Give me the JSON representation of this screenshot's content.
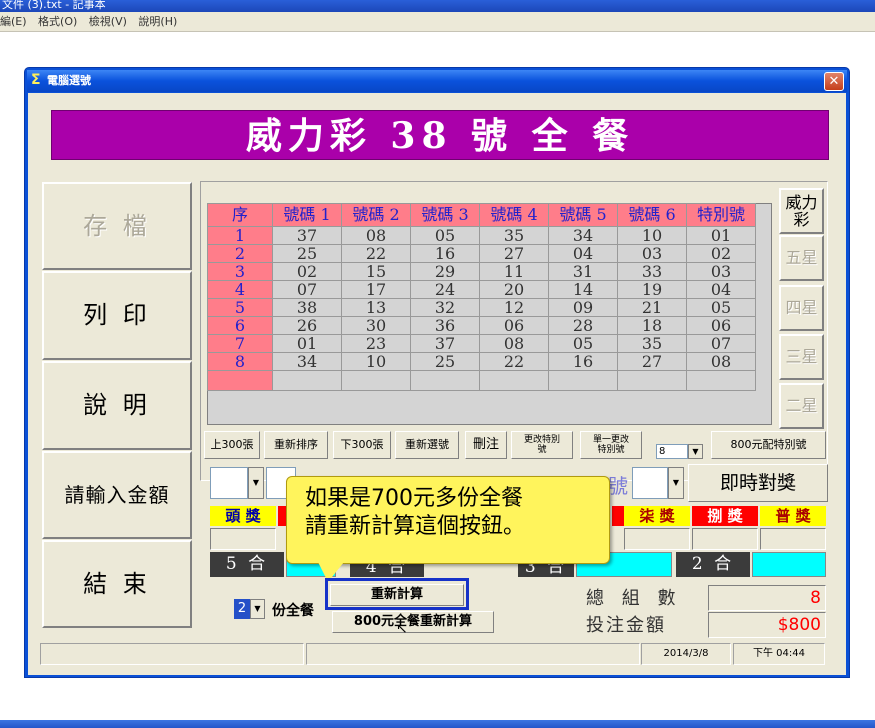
{
  "notepad": {
    "title": "文件 (3).txt - 記事本",
    "menu": [
      "編(E)",
      "格式(O)",
      "檢視(V)",
      "說明(H)"
    ]
  },
  "window": {
    "title": "電腦選號",
    "close": "✕",
    "banner": "威力彩 38 號 全 餐"
  },
  "left_buttons": [
    {
      "label": "存 檔",
      "enabled": false
    },
    {
      "label": "列 印",
      "enabled": true
    },
    {
      "label": "說 明",
      "enabled": true
    },
    {
      "label": "請輸入金額",
      "enabled": true
    },
    {
      "label": "結 束",
      "enabled": true
    }
  ],
  "grid": {
    "headers": [
      "序",
      "號碼 1",
      "號碼 2",
      "號碼 3",
      "號碼 4",
      "號碼 5",
      "號碼 6",
      "特別號"
    ],
    "rows": [
      [
        "1",
        "37",
        "08",
        "05",
        "35",
        "34",
        "10",
        "01"
      ],
      [
        "2",
        "25",
        "22",
        "16",
        "27",
        "04",
        "03",
        "02"
      ],
      [
        "3",
        "02",
        "15",
        "29",
        "11",
        "31",
        "33",
        "03"
      ],
      [
        "4",
        "07",
        "17",
        "24",
        "20",
        "14",
        "19",
        "04"
      ],
      [
        "5",
        "38",
        "13",
        "32",
        "12",
        "09",
        "21",
        "05"
      ],
      [
        "6",
        "26",
        "30",
        "36",
        "06",
        "28",
        "18",
        "06"
      ],
      [
        "7",
        "01",
        "23",
        "37",
        "08",
        "05",
        "35",
        "07"
      ],
      [
        "8",
        "34",
        "10",
        "25",
        "22",
        "16",
        "27",
        "08"
      ]
    ]
  },
  "right_tabs": [
    {
      "label": "威力彩",
      "active": true
    },
    {
      "label": "五星",
      "active": false
    },
    {
      "label": "四星",
      "active": false
    },
    {
      "label": "三星",
      "active": false
    },
    {
      "label": "二星",
      "active": false
    }
  ],
  "toolbar": {
    "prev300": "上300張",
    "resort": "重新排序",
    "next300": "下300張",
    "reselect": "重新選號",
    "delete": "刪注",
    "change_special_1": "更改特別",
    "change_special_2": "號",
    "single_change_1": "單一更改",
    "single_change_2": "特別號",
    "special_select": "8",
    "special_800": "800元配特別號"
  },
  "check_row": {
    "special_glyph": "號",
    "instant_check": "即時對獎"
  },
  "prizes": {
    "first": "頭 獎",
    "seventh": "柒 獎",
    "eighth": "捌 獎",
    "general": "普 獎",
    "hit5": "5 合",
    "hit4": "4 合",
    "hit3": "3 合",
    "hit2": "2 合"
  },
  "sets": {
    "count": "2",
    "label": "份全餐",
    "recalc": "重新計算",
    "recalc800": "800元全餐重新計算"
  },
  "summary": {
    "total_label": "總 組 數",
    "total_value": "8",
    "amount_label": "投注金額",
    "amount_value": "$800"
  },
  "status": {
    "date": "2014/3/8",
    "time": "下午 04:44"
  },
  "callout": {
    "line1": "如果是700元多份全餐",
    "line2": "請重新計算這個按鈕。"
  }
}
